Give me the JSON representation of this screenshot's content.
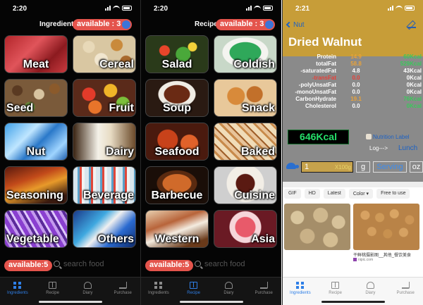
{
  "panes": {
    "ingredients": {
      "status_time": "2:20",
      "header_title": "Ingredients",
      "available_label": "available : 3",
      "tiles": [
        {
          "label": "Meat"
        },
        {
          "label": "Cereal"
        },
        {
          "label": "Seed"
        },
        {
          "label": "Fruit"
        },
        {
          "label": "Nut"
        },
        {
          "label": "Dairy"
        },
        {
          "label": "Seasoning"
        },
        {
          "label": "Beverage"
        },
        {
          "label": "Vegetable"
        },
        {
          "label": "Others"
        }
      ],
      "bottom_available": "available:5",
      "search_placeholder": "search food"
    },
    "recipe": {
      "status_time": "2:20",
      "header_title": "Recipe",
      "available_label": "available : 3",
      "tiles": [
        {
          "label": "Salad"
        },
        {
          "label": "Coldish"
        },
        {
          "label": "Soup"
        },
        {
          "label": "Snack"
        },
        {
          "label": "Seafood"
        },
        {
          "label": "Baked"
        },
        {
          "label": "Barbecue"
        },
        {
          "label": "Cuisine"
        },
        {
          "label": "Western"
        },
        {
          "label": "Asia"
        }
      ],
      "bottom_available": "available:5",
      "search_placeholder": "search food"
    },
    "detail": {
      "status_time": "2:21",
      "back_label": "Nut",
      "title": "Dried Walnut",
      "nutrients": [
        {
          "label": "Protein",
          "value": "14.9",
          "kcal": "60Kcal",
          "value_color": "#e8a23a",
          "kcal_color": "#39c95a",
          "label_color": "#ffffff"
        },
        {
          "label": "totalFat",
          "value": "58.8",
          "kcal": "529Kcal",
          "value_color": "#e8a23a",
          "kcal_color": "#39c95a",
          "label_color": "#ffffff"
        },
        {
          "label": "-saturatedFat",
          "value": "4.8",
          "kcal": "43Kcal",
          "value_color": "#ffffff",
          "kcal_color": "#ffffff",
          "label_color": "#ffffff"
        },
        {
          "label": "-transFat",
          "value": "0.0",
          "kcal": "0Kcal",
          "value_color": "#e8413a",
          "kcal_color": "#ffffff",
          "label_color": "#e8413a"
        },
        {
          "label": "-polyUnsatFat",
          "value": "0.0",
          "kcal": "0Kcal",
          "value_color": "#ffffff",
          "kcal_color": "#ffffff",
          "label_color": "#ffffff"
        },
        {
          "label": "-monoUnsatFat",
          "value": "0.0",
          "kcal": "0Kcal",
          "value_color": "#ffffff",
          "kcal_color": "#ffffff",
          "label_color": "#ffffff"
        },
        {
          "label": "CarbonHydrate",
          "value": "19.1",
          "kcal": "76Kcal",
          "value_color": "#e8a23a",
          "kcal_color": "#39c95a",
          "label_color": "#ffffff"
        },
        {
          "label": "Cholesterol",
          "value": "0.0",
          "kcal": "0Kcal",
          "value_color": "#ffffff",
          "kcal_color": "#39c95a",
          "label_color": "#ffffff"
        }
      ],
      "kcal_total": "646Kcal",
      "nutrition_label": "Nutrition Label",
      "log_label": "Log--->",
      "lunch_label": "Lunch",
      "qty_value": "1",
      "qty_unit": "X100g",
      "unit_g": "g",
      "unit_serving": "Serving",
      "unit_oz": "oz",
      "web_filters": [
        "GIF",
        "HD",
        "Latest",
        "Color ▾",
        "Free to use"
      ],
      "photo_caption": "干鲜桃摄影图__其他_餐饮美食",
      "photo_source": "nipic.com"
    }
  },
  "tabbar": {
    "items": [
      {
        "label": "Ingredients",
        "icon": "grid-icon"
      },
      {
        "label": "Recipe",
        "icon": "book-icon"
      },
      {
        "label": "Diary",
        "icon": "turtle-icon"
      },
      {
        "label": "Purchase",
        "icon": "cart-icon"
      }
    ]
  },
  "colors": {
    "accent_blue": "#2f7fe7",
    "available_red": "#e4544c",
    "header_gold": "#c79d38",
    "kcal_green": "#25e06a"
  }
}
